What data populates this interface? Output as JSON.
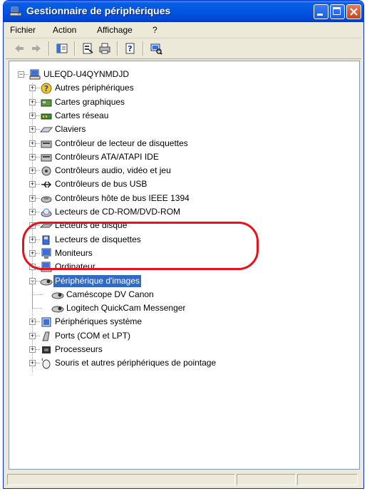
{
  "window": {
    "title": "Gestionnaire de périphériques",
    "accent": "#0054e3",
    "highlight_color": "#e8101a"
  },
  "menubar": {
    "items": [
      "Fichier",
      "Action",
      "Affichage",
      "?"
    ]
  },
  "toolbar": {
    "buttons": [
      "back-icon",
      "forward-icon",
      "show-hide-tree-icon",
      "properties-icon",
      "print-icon",
      "help-icon",
      "scan-hardware-icon"
    ]
  },
  "tree": {
    "root": "ULEQD-U4QYNMDJD",
    "items": [
      {
        "label": "Autres périphériques",
        "icon": "unknown-device-icon",
        "expanded": false
      },
      {
        "label": "Cartes graphiques",
        "icon": "display-adapter-icon",
        "expanded": false
      },
      {
        "label": "Cartes réseau",
        "icon": "network-adapter-icon",
        "expanded": false
      },
      {
        "label": "Claviers",
        "icon": "keyboard-icon",
        "expanded": false
      },
      {
        "label": "Contrôleur de lecteur de disquettes",
        "icon": "floppy-controller-icon",
        "expanded": false
      },
      {
        "label": "Contrôleurs ATA/ATAPI IDE",
        "icon": "ide-controller-icon",
        "expanded": false
      },
      {
        "label": "Contrôleurs audio, vidéo et jeu",
        "icon": "audio-icon",
        "expanded": false
      },
      {
        "label": "Contrôleurs de bus USB",
        "icon": "usb-icon",
        "expanded": false
      },
      {
        "label": "Contrôleurs hôte de bus IEEE 1394",
        "icon": "firewire-icon",
        "expanded": false
      },
      {
        "label": "Lecteurs de CD-ROM/DVD-ROM",
        "icon": "cdrom-icon",
        "expanded": false
      },
      {
        "label": "Lecteurs de disque",
        "icon": "disk-drive-icon",
        "expanded": false
      },
      {
        "label": "Lecteurs de disquettes",
        "icon": "floppy-drive-icon",
        "expanded": false
      },
      {
        "label": "Moniteurs",
        "icon": "monitor-icon",
        "expanded": false
      },
      {
        "label": "Ordinateur",
        "icon": "computer-icon",
        "expanded": false
      },
      {
        "label": "Périphérique d'images",
        "icon": "imaging-device-icon",
        "expanded": true,
        "selected": true,
        "children": [
          "Caméscope DV Canon",
          "Logitech QuickCam Messenger"
        ]
      },
      {
        "label": "Périphériques système",
        "icon": "system-device-icon",
        "expanded": false
      },
      {
        "label": "Ports (COM et LPT)",
        "icon": "port-icon",
        "expanded": false
      },
      {
        "label": "Processeurs",
        "icon": "processor-icon",
        "expanded": false
      },
      {
        "label": "Souris et autres périphériques de pointage",
        "icon": "mouse-icon",
        "expanded": false
      }
    ]
  }
}
